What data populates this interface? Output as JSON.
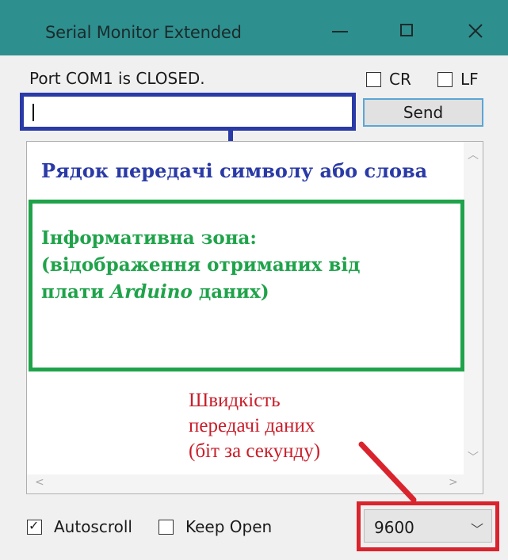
{
  "window": {
    "title": "Serial Monitor Extended",
    "title_bar_color": "#2e8f8f"
  },
  "status": {
    "text": "Port COM1 is CLOSED."
  },
  "options": {
    "cr_label": "CR",
    "lf_label": "LF",
    "cr_checked": false,
    "lf_checked": false
  },
  "input": {
    "value": ""
  },
  "send_button": {
    "label": "Send"
  },
  "annotations": {
    "input_caption": "Рядок передачі символу або слова",
    "info_line1": "Інформативна зона:",
    "info_line2": "(відображення отриманих від",
    "info_line3_prefix": "плати ",
    "info_line3_italic": "Arduino",
    "info_line3_suffix": " даних)",
    "speed_line1": "Швидкість",
    "speed_line2": "передачі даних",
    "speed_line3": "(біт за секунду)",
    "colors": {
      "input": "#2a3aa6",
      "info": "#1fa34a",
      "speed": "#c81e2a"
    }
  },
  "bottom": {
    "autoscroll_label": "Autoscroll",
    "autoscroll_checked": true,
    "keep_open_label": "Keep Open",
    "keep_open_checked": false,
    "baud_rate": "9600"
  },
  "icons": {
    "minimize": "minimize-icon",
    "maximize": "maximize-icon",
    "close": "close-icon",
    "dropdown": "chevron-down-icon"
  }
}
